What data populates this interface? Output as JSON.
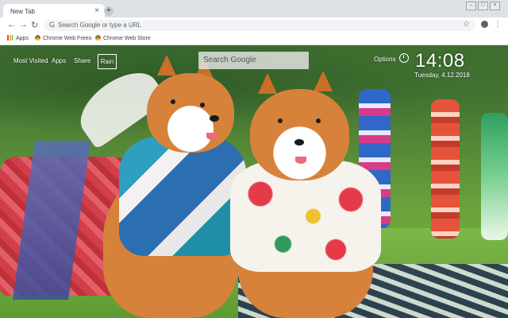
{
  "tab": {
    "title": "New Tab",
    "close": "×",
    "new_tab": "+"
  },
  "window": {
    "minimize": "–",
    "maximize": "□",
    "close": "×"
  },
  "toolbar": {
    "back": "←",
    "forward": "→",
    "reload": "↻",
    "omnibox_placeholder": "Search Google or type a URL",
    "star": "☆",
    "menu": "⋮"
  },
  "bookmarks": [
    {
      "label": "Apps"
    },
    {
      "label": "Chrome Web Freeo"
    },
    {
      "label": "Chrome Web Store"
    }
  ],
  "ntp": {
    "links": [
      "Most Visited",
      "Apps",
      "Share"
    ],
    "rain_label": "Rain",
    "search_placeholder": "Search Google",
    "options_label": "Options",
    "time": "14:08",
    "date": "Tuesday, 4.12.2018"
  },
  "icons": {
    "back": "back-arrow-icon",
    "forward": "forward-arrow-icon",
    "reload": "reload-icon",
    "google": "google-g-icon",
    "star": "star-icon",
    "profile": "profile-icon",
    "menu": "kebab-menu-icon",
    "apps": "apps-grid-icon",
    "clock": "clock-icon"
  },
  "colors": {
    "tabstrip": "#dee1e6",
    "omnibox": "#f1f3f4",
    "overlay_text": "#ffffff"
  }
}
